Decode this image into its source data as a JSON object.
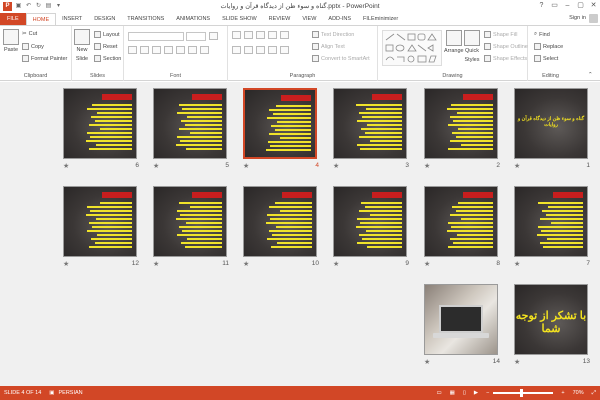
{
  "window": {
    "title": "گناه و سوء ظن از دیدگاه قرآن و روایات.pptx - PowerPoint",
    "controls": [
      "?",
      "▭",
      "–",
      "▢",
      "✕"
    ]
  },
  "tabs": [
    "FILE",
    "HOME",
    "INSERT",
    "DESIGN",
    "TRANSITIONS",
    "ANIMATIONS",
    "SLIDE SHOW",
    "REVIEW",
    "VIEW",
    "ADD-INS",
    "FILEminimizer"
  ],
  "active_tab": "HOME",
  "signin": "Sign in",
  "ribbon": {
    "clipboard": {
      "label": "Clipboard",
      "paste": "Paste",
      "cut": "Cut",
      "copy": "Copy",
      "format_painter": "Format Painter"
    },
    "slides": {
      "label": "Slides",
      "new_slide": "New",
      "new_slide2": "Slide",
      "layout": "Layout",
      "reset": "Reset",
      "section": "Section"
    },
    "font": {
      "label": "Font"
    },
    "paragraph": {
      "label": "Paragraph",
      "text_direction": "Text Direction",
      "align_text": "Align Text",
      "smartart": "Convert to SmartArt"
    },
    "drawing": {
      "label": "Drawing",
      "arrange": "Arrange",
      "quick_styles": "Quick",
      "quick_styles2": "Styles",
      "shape_fill": "Shape Fill",
      "shape_outline": "Shape Outline",
      "shape_effects": "Shape Effects"
    },
    "editing": {
      "label": "Editing",
      "find": "Find",
      "replace": "Replace",
      "select": "Select"
    }
  },
  "slides": [
    {
      "number": "1",
      "kind": "title-only",
      "selected": false
    },
    {
      "number": "2",
      "kind": "text",
      "selected": false
    },
    {
      "number": "3",
      "kind": "text",
      "selected": false
    },
    {
      "number": "4",
      "kind": "text",
      "selected": true
    },
    {
      "number": "5",
      "kind": "text",
      "selected": false
    },
    {
      "number": "6",
      "kind": "text",
      "selected": false
    },
    {
      "number": "7",
      "kind": "text",
      "selected": false
    },
    {
      "number": "8",
      "kind": "text",
      "selected": false
    },
    {
      "number": "9",
      "kind": "text",
      "selected": false
    },
    {
      "number": "10",
      "kind": "text",
      "selected": false
    },
    {
      "number": "11",
      "kind": "text",
      "selected": false
    },
    {
      "number": "12",
      "kind": "text",
      "selected": false
    },
    {
      "number": "13",
      "kind": "closing",
      "selected": false
    },
    {
      "number": "14",
      "kind": "photo",
      "selected": false
    }
  ],
  "slide1_text": "گناه و سوء ظن از دیدگاه قرآن و روایات",
  "slide13_text": "با تشکر از توجه شما",
  "statusbar": {
    "slide_of": "SLIDE 4 OF 14",
    "language": "PERSIAN",
    "zoom": "70%"
  },
  "colors": {
    "accent": "#d24726",
    "title_red": "#d81c1c",
    "text_yellow": "#f0e32a"
  }
}
